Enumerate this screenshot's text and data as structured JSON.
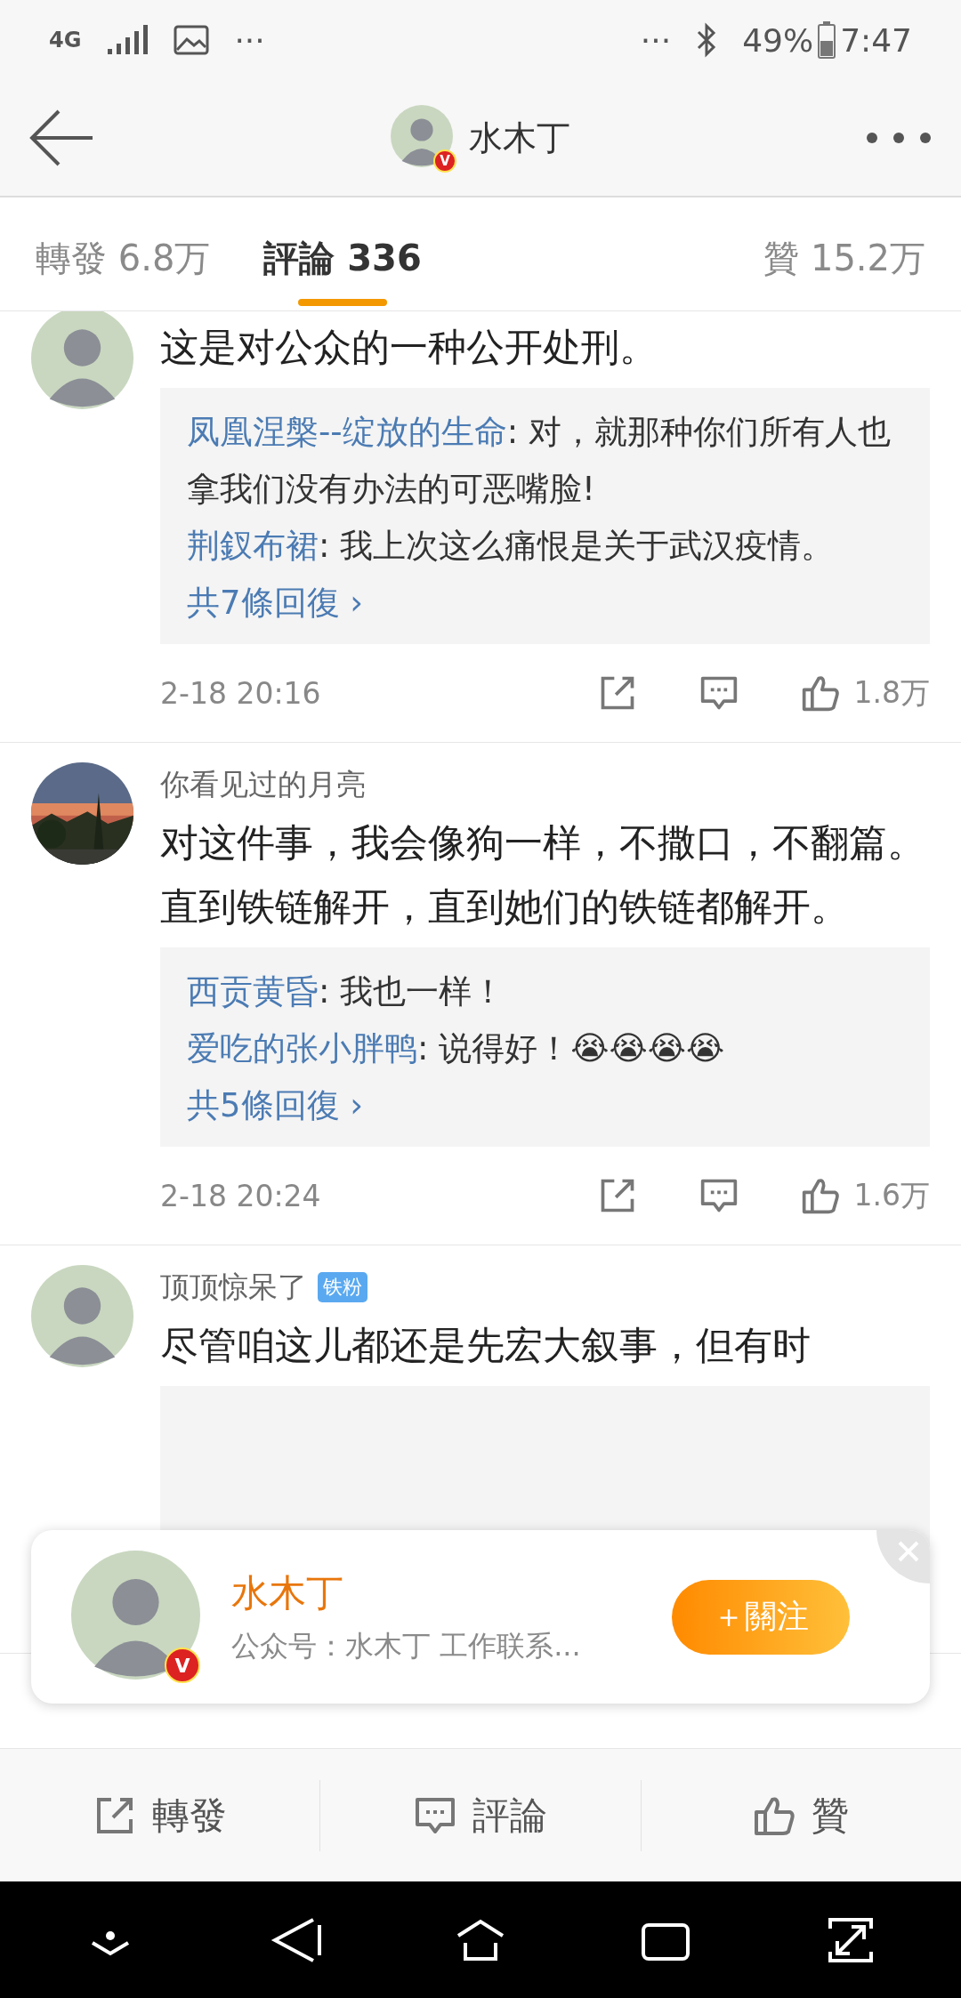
{
  "status_bar": {
    "network": "4G",
    "left_more": "···",
    "right_more": "···",
    "battery_text": "49%",
    "time": "7:47"
  },
  "header": {
    "title": "水木丁",
    "verified": true,
    "verified_badge": "V"
  },
  "tabs": [
    {
      "label": "轉發 6.8万",
      "selected": false
    },
    {
      "label": "評論 336",
      "selected": true
    },
    {
      "label": "贊 15.2万",
      "selected": false
    }
  ],
  "comments": [
    {
      "avatar": {
        "kind": "person"
      },
      "body": "这是对公众的一种公开处刑。",
      "replies": [
        {
          "user": "凤凰涅槃--绽放的生命",
          "text": ": 对，就那种你们所有人也拿我们没有办法的可恶嘴脸!"
        },
        {
          "user": "荆釵布裙",
          "text": ": 我上次这么痛恨是关于武汉疫情。"
        }
      ],
      "more": "共7條回復 ›",
      "time": "2-18 20:16",
      "likes": "1.8万"
    },
    {
      "avatar": {
        "kind": "picture"
      },
      "username": "你看见过的月亮",
      "body": "对这件事，我会像狗一样，不撒口，不翻篇。直到铁链解开，直到她们的铁链都解开。",
      "replies": [
        {
          "user": "西贡黄昏",
          "text": ": 我也一样！"
        },
        {
          "user": "爱吃的张小胖鸭",
          "text": ": 说得好！😭😭😭😭"
        }
      ],
      "more": "共5條回復 ›",
      "time": "2-18 20:24",
      "likes": "1.6万"
    },
    {
      "avatar": {
        "kind": "person"
      },
      "username": "顶顶惊呆了",
      "badge": "铁粉",
      "body": " 尽管咱这儿都还是先宏大叙事，但有时"
    }
  ],
  "popup": {
    "name": "水木丁",
    "verified_badge": "V",
    "subtitle": "公众号：水木丁  工作联系...",
    "follow": "＋關注"
  },
  "bottom_actions": [
    {
      "kind": "repost",
      "label": "轉發"
    },
    {
      "kind": "comment",
      "label": "評論"
    },
    {
      "kind": "like",
      "label": "贊"
    }
  ]
}
